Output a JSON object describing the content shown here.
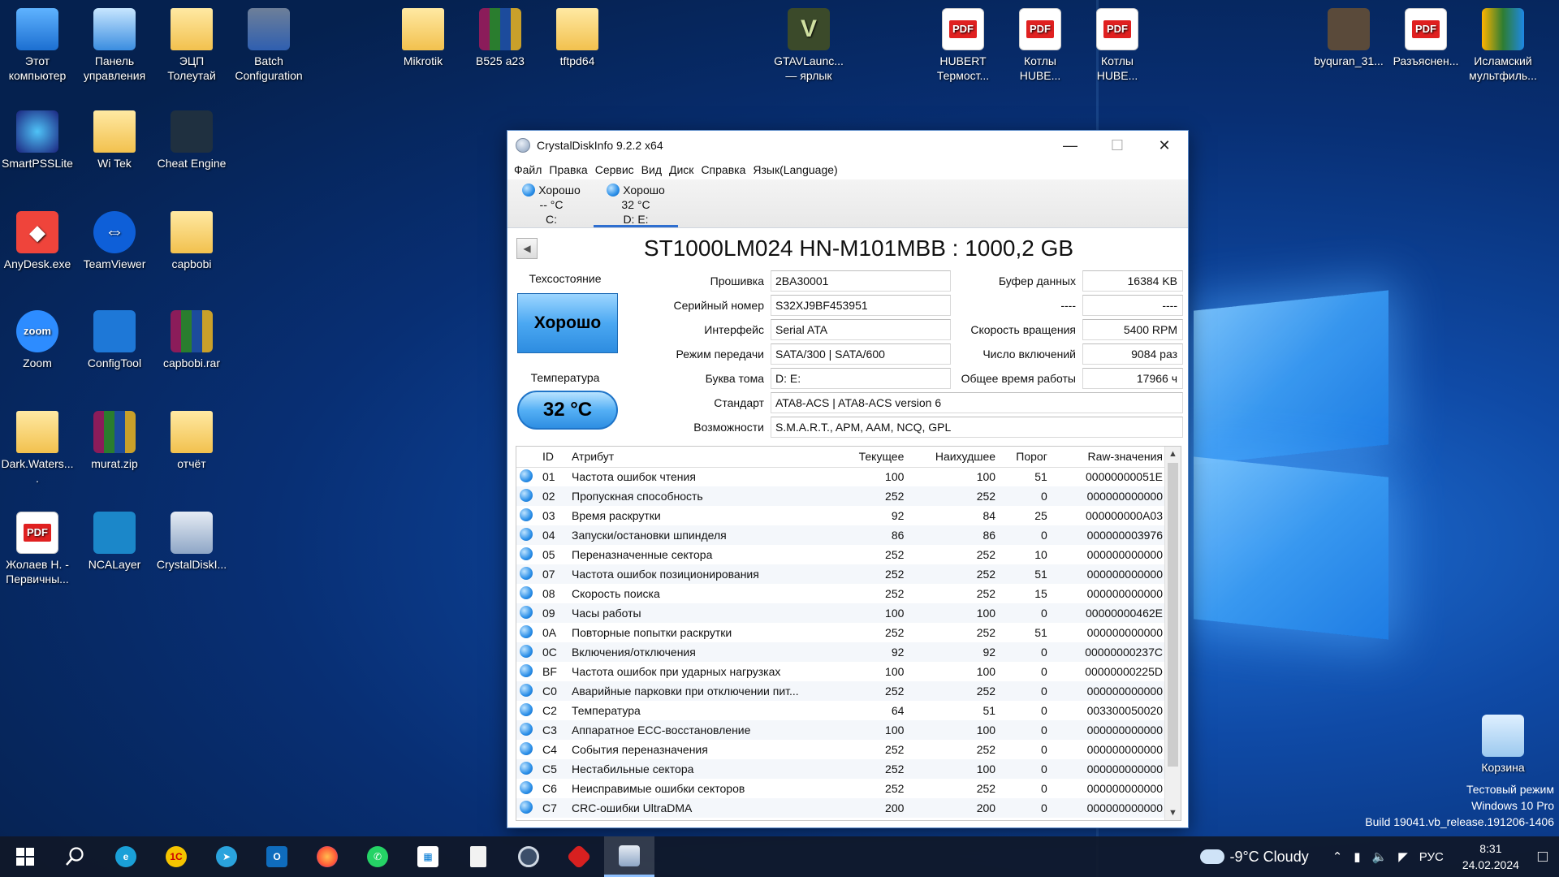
{
  "desktop": {
    "icons": [
      {
        "label": "Этот компьютер",
        "icon": "computer-icon"
      },
      {
        "label": "Панель управления",
        "icon": "control-panel-icon"
      },
      {
        "label": "ЭЦП Толеутай",
        "icon": "folder-icon"
      },
      {
        "label": "Batch Configuration",
        "icon": "gear-icon"
      },
      {
        "label": "Mikrotik",
        "icon": "folder-icon"
      },
      {
        "label": "B525 a23",
        "icon": "archive-icon"
      },
      {
        "label": "tftpd64",
        "icon": "folder-icon"
      },
      {
        "label": "GTAVLaunc... — ярлык",
        "icon": "gta-icon"
      },
      {
        "label": "HUBERT Термост...",
        "icon": "pdf-icon"
      },
      {
        "label": "Котлы HUBE...",
        "icon": "pdf-icon"
      },
      {
        "label": "Котлы HUBE...",
        "icon": "pdf-icon"
      },
      {
        "label": "byquran_31...",
        "icon": "image-icon"
      },
      {
        "label": "Разъяснен...",
        "icon": "pdf-icon"
      },
      {
        "label": "Исламский мультфиль...",
        "icon": "video-icon"
      },
      {
        "label": "SmartPSSLite",
        "icon": "smartpss-icon"
      },
      {
        "label": "Wi Tek",
        "icon": "folder-icon"
      },
      {
        "label": "Cheat Engine",
        "icon": "cheat-engine-icon"
      },
      {
        "label": "AnyDesk.exe",
        "icon": "anydesk-icon"
      },
      {
        "label": "TeamViewer",
        "icon": "teamviewer-icon"
      },
      {
        "label": "capbobi",
        "icon": "folder-icon"
      },
      {
        "label": "Zoom",
        "icon": "zoom-icon"
      },
      {
        "label": "ConfigTool",
        "icon": "configtool-icon"
      },
      {
        "label": "capbobi.rar",
        "icon": "archive-icon"
      },
      {
        "label": "Dark.Waters....",
        "icon": "folder-icon"
      },
      {
        "label": "murat.zip",
        "icon": "archive-icon"
      },
      {
        "label": "отчёт",
        "icon": "pdf-folder-icon"
      },
      {
        "label": "Жолаев Н. - Первичны...",
        "icon": "pdf-icon"
      },
      {
        "label": "NCALayer",
        "icon": "ncalayer-icon"
      },
      {
        "label": "CrystalDiskI...",
        "icon": "crystaldisk-icon"
      },
      {
        "label": "Корзина",
        "icon": "recycle-bin-icon"
      }
    ],
    "watermark": [
      "Тестовый режим",
      "Windows 10 Pro",
      "Build 19041.vb_release.191206-1406"
    ]
  },
  "window": {
    "title": "CrystalDiskInfo 9.2.2 x64",
    "menu": [
      "Файл",
      "Правка",
      "Сервис",
      "Вид",
      "Диск",
      "Справка",
      "Язык(Language)"
    ],
    "disks": [
      {
        "status": "Хорошо",
        "temp": "-- °C",
        "letter": "C:"
      },
      {
        "status": "Хорошо",
        "temp": "32 °C",
        "letter": "D: E:"
      }
    ],
    "model": "ST1000LM024 HN-M101MBB : 1000,2 GB",
    "health_label": "Техсостояние",
    "health_value": "Хорошо",
    "temp_label": "Температура",
    "temp_value": "32 °C",
    "fields": {
      "firmware_label": "Прошивка",
      "firmware": "2BA30001",
      "serial_label": "Серийный номер",
      "serial": "S32XJ9BF453951",
      "interface_label": "Интерфейс",
      "interface": "Serial ATA",
      "transfer_label": "Режим передачи",
      "transfer": "SATA/300 | SATA/600",
      "letter_label": "Буква тома",
      "letter": "D: E:",
      "standard_label": "Стандарт",
      "standard": "ATA8-ACS | ATA8-ACS version 6",
      "features_label": "Возможности",
      "features": "S.M.A.R.T., APM, AAM, NCQ, GPL",
      "buffer_label": "Буфер данных",
      "buffer": "16384 KB",
      "blank_label": "----",
      "blank": "----",
      "rpm_label": "Скорость вращения",
      "rpm": "5400 RPM",
      "poweron_label": "Число включений",
      "poweron": "9084 раз",
      "hours_label": "Общее время работы",
      "hours": "17966 ч"
    },
    "smart_headers": [
      "ID",
      "Атрибут",
      "Текущее",
      "Наихудшее",
      "Порог",
      "Raw-значения"
    ],
    "smart": [
      [
        "01",
        "Частота ошибок чтения",
        "100",
        "100",
        "51",
        "00000000051E"
      ],
      [
        "02",
        "Пропускная способность",
        "252",
        "252",
        "0",
        "000000000000"
      ],
      [
        "03",
        "Время раскрутки",
        "92",
        "84",
        "25",
        "000000000A03"
      ],
      [
        "04",
        "Запуски/остановки шпинделя",
        "86",
        "86",
        "0",
        "000000003976"
      ],
      [
        "05",
        "Переназначенные сектора",
        "252",
        "252",
        "10",
        "000000000000"
      ],
      [
        "07",
        "Частота ошибок позиционирования",
        "252",
        "252",
        "51",
        "000000000000"
      ],
      [
        "08",
        "Скорость поиска",
        "252",
        "252",
        "15",
        "000000000000"
      ],
      [
        "09",
        "Часы работы",
        "100",
        "100",
        "0",
        "00000000462E"
      ],
      [
        "0A",
        "Повторные попытки раскрутки",
        "252",
        "252",
        "51",
        "000000000000"
      ],
      [
        "0C",
        "Включения/отключения",
        "92",
        "92",
        "0",
        "00000000237C"
      ],
      [
        "BF",
        "Частота ошибок при ударных нагрузках",
        "100",
        "100",
        "0",
        "00000000225D"
      ],
      [
        "C0",
        "Аварийные парковки при отключении пит...",
        "252",
        "252",
        "0",
        "000000000000"
      ],
      [
        "C2",
        "Температура",
        "64",
        "51",
        "0",
        "003300050020"
      ],
      [
        "C3",
        "Аппаратное ECC-восстановление",
        "100",
        "100",
        "0",
        "000000000000"
      ],
      [
        "C4",
        "События переназначения",
        "252",
        "252",
        "0",
        "000000000000"
      ],
      [
        "C5",
        "Нестабильные сектора",
        "252",
        "100",
        "0",
        "000000000000"
      ],
      [
        "C6",
        "Неисправимые ошибки секторов",
        "252",
        "252",
        "0",
        "000000000000"
      ],
      [
        "C7",
        "CRC-ошибки UltraDMA",
        "200",
        "200",
        "0",
        "000000000000"
      ]
    ]
  },
  "taskbar": {
    "weather": "-9°C Cloudy",
    "lang": "РУС",
    "time": "8:31",
    "date": "24.02.2024"
  }
}
